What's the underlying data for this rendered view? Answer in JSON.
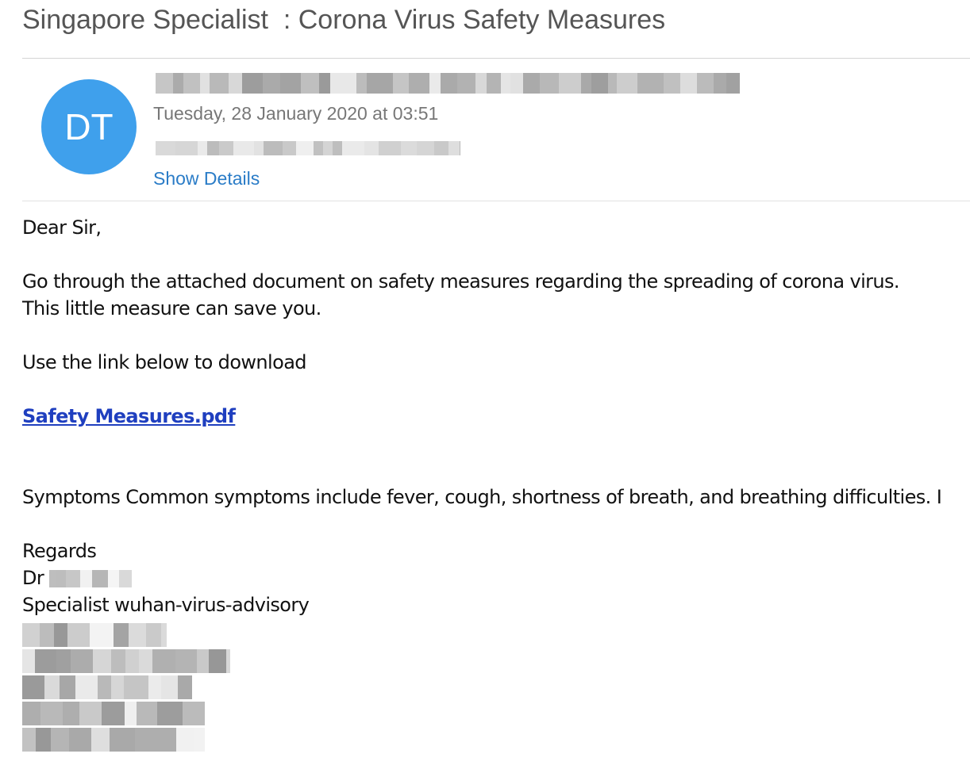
{
  "email": {
    "subject": "Singapore Specialist  : Corona Virus Safety Measures",
    "avatar_initials": "DT",
    "date": "Tuesday, 28 January 2020 at 03:51",
    "show_details_label": "Show Details",
    "sender_redacted": true,
    "recipient_redacted": true
  },
  "body": {
    "greeting": "Dear Sir,",
    "line1": "Go through the attached document on safety measures regarding the spreading of corona virus.",
    "line2": "This little measure can save you.",
    "line3": "Use the link below to download",
    "link_text": "Safety Measures.pdf",
    "symptoms": "Symptoms  Common symptoms include fever, cough, shortness of breath, and breathing difficulties. I",
    "regards": "Regards",
    "dr_prefix": "Dr",
    "signature_title": "Specialist wuhan-virus-advisory"
  },
  "colors": {
    "avatar_bg": "#3fa0ec",
    "link": "#1f3fbf",
    "show_details": "#2a7cc7"
  }
}
